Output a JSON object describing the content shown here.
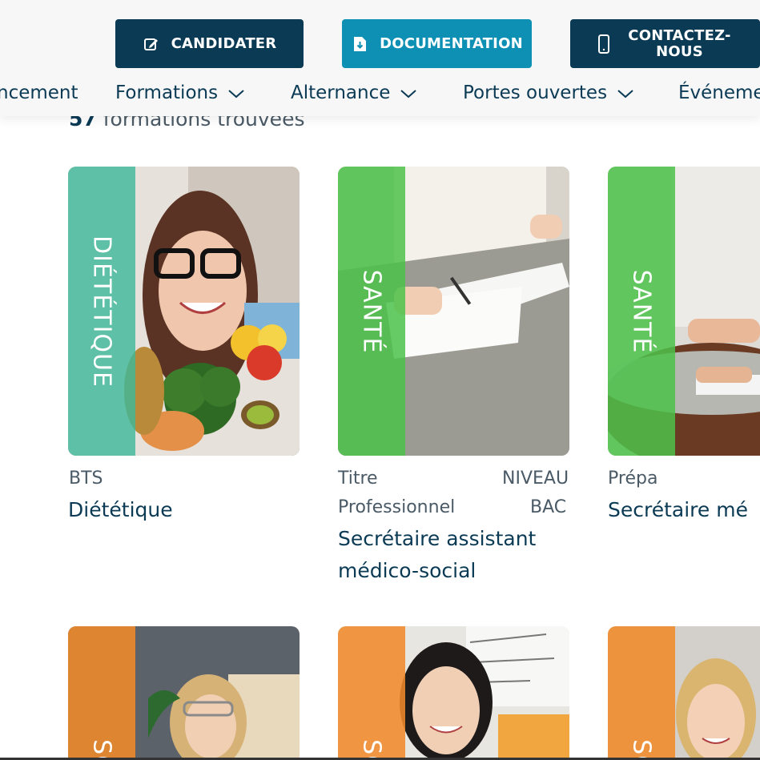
{
  "header": {
    "buttons": {
      "candidater": "CANDIDATER",
      "documentation": "DOCUMENTATION",
      "contact_line1": "CONTACTEZ-",
      "contact_line2": "NOUS"
    },
    "nav": [
      "ncement",
      "Formations",
      "Alternance",
      "Portes ouvertes",
      "Événeme"
    ]
  },
  "results": {
    "count": "57",
    "label": "formations trouvées"
  },
  "cards": [
    {
      "category": "DIÉTÉTIQUE",
      "level": "BTS",
      "level_right": "",
      "level_line2": "",
      "level_line2_right": "",
      "title": "Diététique",
      "title2": "",
      "band_color": "#3fb89a"
    },
    {
      "category": "SANTÉ",
      "level": "Titre",
      "level_right": "NIVEAU",
      "level_line2": "Professionnel",
      "level_line2_right": "BAC",
      "title": "Secrétaire assistant",
      "title2": "médico-social",
      "band_color": "#4cc24a"
    },
    {
      "category": "SANTÉ",
      "level": "Prépa",
      "level_right": "",
      "level_line2": "",
      "level_line2_right": "",
      "title": "Secrétaire mé",
      "title2": "",
      "band_color": "#4cc24a"
    },
    {
      "category": "SO",
      "band_color": "#f08a2a"
    },
    {
      "category": "SO",
      "band_color": "#f08a2a"
    },
    {
      "category": "SO",
      "band_color": "#f08a2a"
    }
  ]
}
